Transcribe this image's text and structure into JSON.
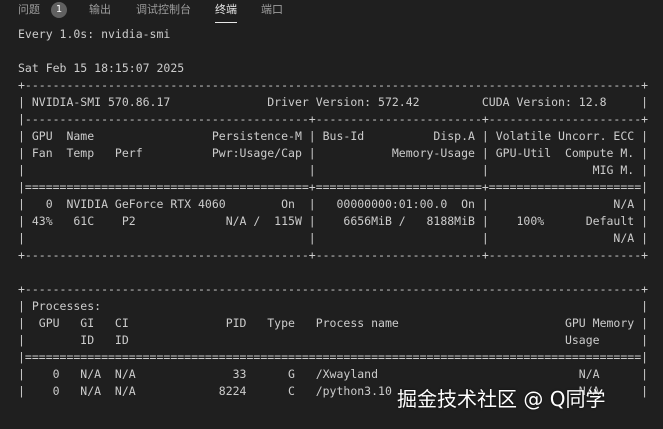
{
  "tabs": [
    {
      "label": "问题",
      "badge": "1"
    },
    {
      "label": "输出"
    },
    {
      "label": "调试控制台"
    },
    {
      "label": "终端"
    },
    {
      "label": "端口"
    }
  ],
  "active_tab": "终端",
  "terminal": {
    "lines": [
      "Every 1.0s: nvidia-smi",
      "",
      "Sat Feb 15 18:15:07 2025",
      "+-----------------------------------------------------------------------------------------+",
      "| NVIDIA-SMI 570.86.17              Driver Version: 572.42         CUDA Version: 12.8     |",
      "|-----------------------------------------+------------------------+----------------------+",
      "| GPU  Name                 Persistence-M | Bus-Id          Disp.A | Volatile Uncorr. ECC |",
      "| Fan  Temp   Perf          Pwr:Usage/Cap |           Memory-Usage | GPU-Util  Compute M. |",
      "|                                         |                        |               MIG M. |",
      "|=========================================+========================+======================|",
      "|   0  NVIDIA GeForce RTX 4060        On  |   00000000:01:00.0  On |                  N/A |",
      "| 43%   61C    P2             N/A /  115W |    6656MiB /   8188MiB |    100%      Default |",
      "|                                         |                        |                  N/A |",
      "+-----------------------------------------+------------------------+----------------------+",
      "",
      "+-----------------------------------------------------------------------------------------+",
      "| Processes:                                                                              |",
      "|  GPU   GI   CI              PID   Type   Process name                        GPU Memory |",
      "|        ID   ID                                                               Usage      |",
      "|=========================================================================================|",
      "|    0   N/A  N/A              33      G   /Xwayland                             N/A      |",
      "|    0   N/A  N/A            8224      C   /python3.10                           N/A      |"
    ]
  },
  "watermark": "掘金技术社区 @ Q同学"
}
